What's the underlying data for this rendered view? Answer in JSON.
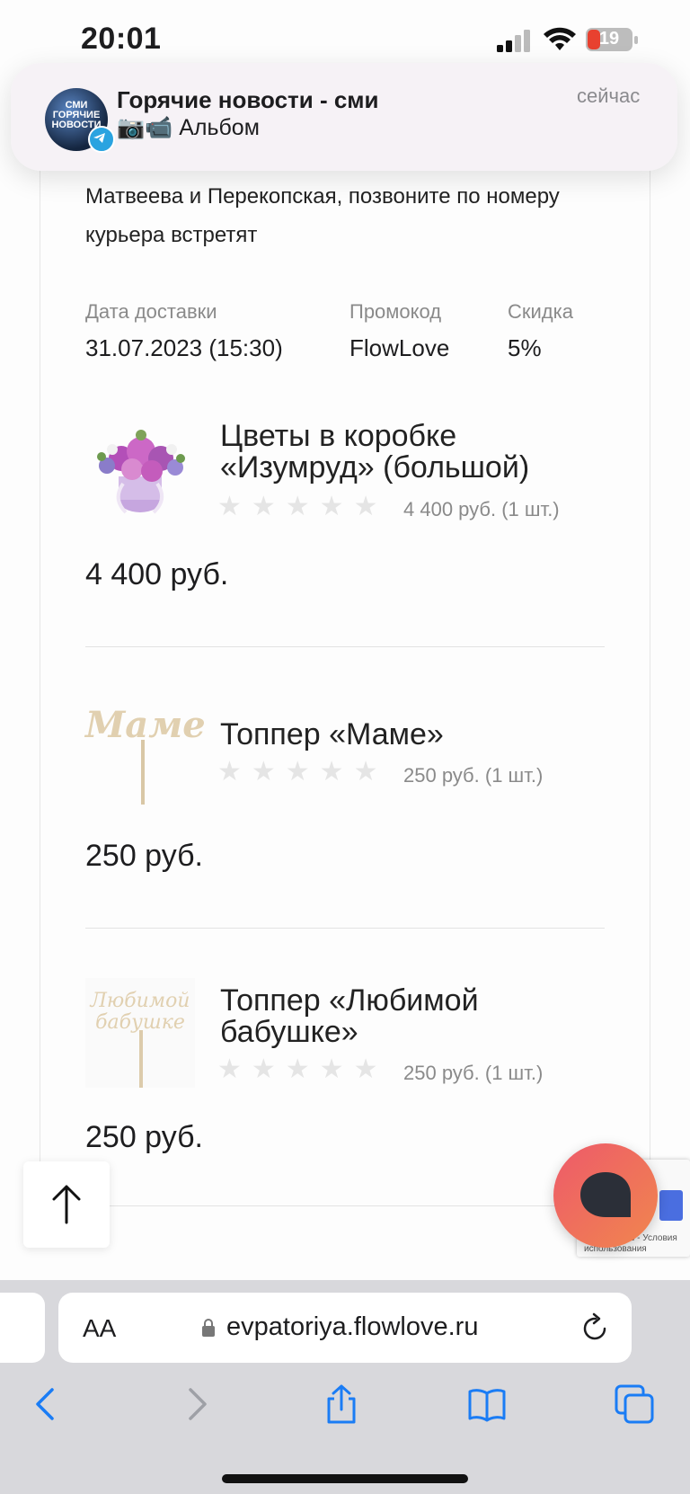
{
  "status": {
    "time": "20:01",
    "battery": "19"
  },
  "notification": {
    "app_name": "Горячие новости - сми",
    "subtitle": "📷📹 Альбом",
    "time": "сейчас",
    "avatar_text": "СМИ ГОРЯЧИЕ НОВОСТИ"
  },
  "order": {
    "address_note": "Матвеева и Перекопская, позвоните по номеру курьера встретят",
    "delivery_label": "Дата доставки",
    "delivery_value": "31.07.2023 (15:30)",
    "promo_label": "Промокод",
    "promo_value": "FlowLove",
    "discount_label": "Скидка",
    "discount_value": "5%"
  },
  "products": [
    {
      "name": "Цветы в коробке «Изумруд» (большой)",
      "stars": "★★★★★",
      "rating": 0,
      "unit_price": "4 400 руб. (1 шт.)",
      "total": "4 400 руб."
    },
    {
      "name": "Топпер «Маме»",
      "stars": "★★★★★",
      "rating": 0,
      "unit_price": "250 руб. (1 шт.)",
      "total": "250 руб.",
      "image_text": "Маме"
    },
    {
      "name": "Топпер «Любимой бабушке»",
      "stars": "★★★★★",
      "rating": 0,
      "unit_price": "250 руб. (1 шт.)",
      "total": "250 руб.",
      "image_text": "Любимой бабушке"
    }
  ],
  "recaptcha": {
    "text": "...иальность - Условия использования"
  },
  "browser": {
    "aa_label": "AA",
    "url": "evpatoriya.flowlove.ru"
  },
  "icons": [
    "signal-icon",
    "wifi-icon",
    "battery-icon",
    "telegram-icon",
    "arrow-up-icon",
    "chat-icon",
    "lock-icon",
    "reload-icon",
    "back-icon",
    "forward-icon",
    "share-icon",
    "bookmarks-icon",
    "tabs-icon"
  ],
  "colors": {
    "accent_blue": "#1a7cf5",
    "chat_gradient_start": "#ee5a6a",
    "chat_gradient_end": "#f0864e"
  }
}
